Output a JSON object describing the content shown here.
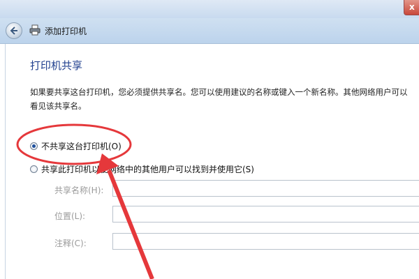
{
  "window": {
    "title": "添加打印机",
    "close_glyph": "x"
  },
  "page": {
    "heading": "打印机共享",
    "description": "如果要共享这台打印机，您必须提供共享名。您可以使用建议的名称或键入一个新名称。其他网络用户可以看见该共享名。"
  },
  "options": [
    {
      "label": "不共享这台打印机(O)",
      "checked": true
    },
    {
      "label": "共享此打印机以便网络中的其他用户可以找到并使用它(S)",
      "checked": false
    }
  ],
  "fields": [
    {
      "label": "共享名称(H):",
      "value": ""
    },
    {
      "label": "位置(L):",
      "value": ""
    },
    {
      "label": "注释(C):",
      "value": ""
    }
  ],
  "colors": {
    "heading": "#1f3f8e",
    "annotation": "#e5383b"
  },
  "icons": {
    "back": "back-arrow-icon",
    "printer": "printer-icon"
  }
}
